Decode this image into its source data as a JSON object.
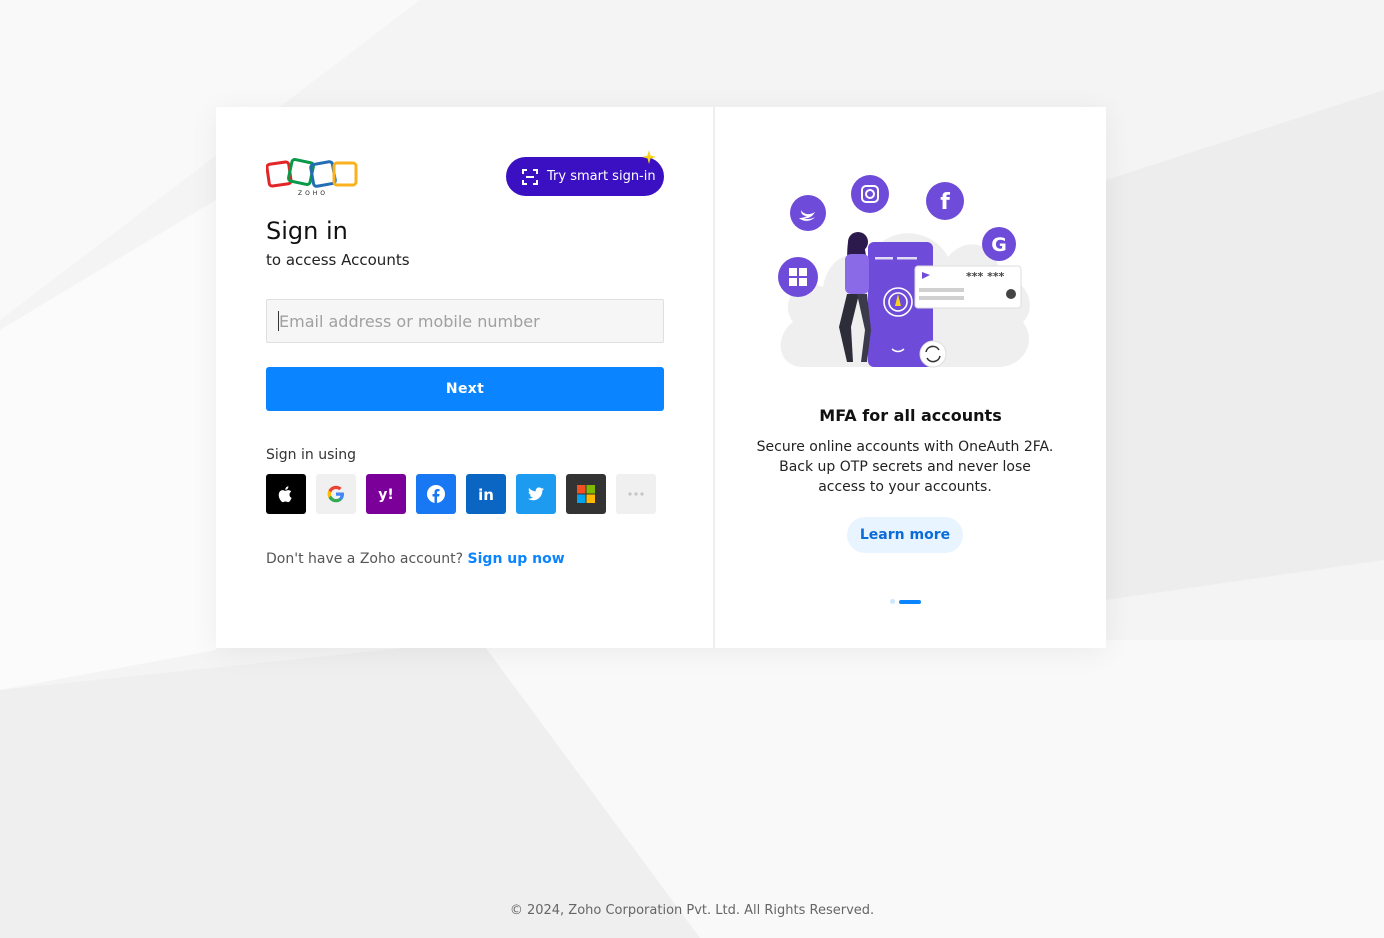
{
  "brand": {
    "logo_text": "ZOHO"
  },
  "header": {
    "smart_signin_label": "Try smart sign-in"
  },
  "signin": {
    "title": "Sign in",
    "subtitle": "to access Accounts",
    "email_placeholder": "Email address or mobile number",
    "email_value": "",
    "next_label": "Next"
  },
  "social": {
    "heading": "Sign in using",
    "providers": [
      {
        "icon": "apple-icon",
        "color": "#000000"
      },
      {
        "icon": "google-icon",
        "color": "#f0f0f0"
      },
      {
        "icon": "yahoo-icon",
        "color": "#7b0099"
      },
      {
        "icon": "facebook-icon",
        "color": "#1877f2"
      },
      {
        "icon": "linkedin-icon",
        "color": "#0a66c2"
      },
      {
        "icon": "twitter-icon",
        "color": "#1d9bf0"
      },
      {
        "icon": "microsoft-icon",
        "color": "#333333"
      },
      {
        "icon": "more-icon",
        "color": "#f0f0f0"
      }
    ]
  },
  "signup": {
    "prompt": "Don't have a Zoho account?",
    "link": "Sign up now"
  },
  "promo": {
    "title": "MFA for all accounts",
    "description": "Secure online accounts with OneAuth 2FA. Back up OTP secrets and never lose access to your accounts.",
    "cta": "Learn more",
    "masked_password": "*** ***",
    "slide_count": 2,
    "active_slide": 2
  },
  "footer": {
    "copyright": "© 2024, Zoho Corporation Pvt. Ltd. All Rights Reserved."
  },
  "colors": {
    "accent": "#0a84ff",
    "smart_signin": "#3a10c2",
    "illustration": "#6e4bd8"
  }
}
